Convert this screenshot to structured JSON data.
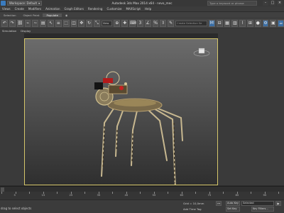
{
  "titlebar": {
    "workspace": "Workspace: Default",
    "title": "Autodesk 3ds Max 2014 x64 - nevo_mec",
    "search_placeholder": "Type a keyword or phrase"
  },
  "menu": [
    "Edit",
    "Tools",
    "Group",
    "Views",
    "Create",
    "Modifiers",
    "Animation",
    "Graph Editors",
    "Rendering",
    "Customize",
    "MAXScript",
    "Help"
  ],
  "menu_visible": [
    "Views",
    "Create",
    "Modifiers",
    "Animation",
    "Graph Editors",
    "Rendering",
    "Customize",
    "MAXScript",
    "Help"
  ],
  "ribbon_tabs": [
    "Selection",
    "Object Paint",
    "Populate"
  ],
  "ribbon_active": "Populate",
  "toolbar": {
    "filter_value": "View",
    "selection_set_placeholder": "Create Selection Se"
  },
  "subbar": [
    "Simulation",
    "Display"
  ],
  "timeline": {
    "ticks": [
      "0",
      "5",
      "10",
      "15",
      "20",
      "25",
      "30",
      "35",
      "40",
      "45",
      "50",
      "55",
      "60",
      "65",
      "70",
      "75",
      "80",
      "85",
      "90",
      "95",
      "100"
    ]
  },
  "status": {
    "prompt": "drag to select objects",
    "grid": "Grid = 10,0mm",
    "auto_key": "Auto Key",
    "selected": "Selected",
    "set_key": "Set Key",
    "key_filters": "Key Filters...",
    "add_time_tag": "Add Time Tag"
  },
  "colors": {
    "viewport_border": "#d5c66a",
    "ui_dark": "#3b3b3b",
    "accent": "#3a6ea5"
  }
}
